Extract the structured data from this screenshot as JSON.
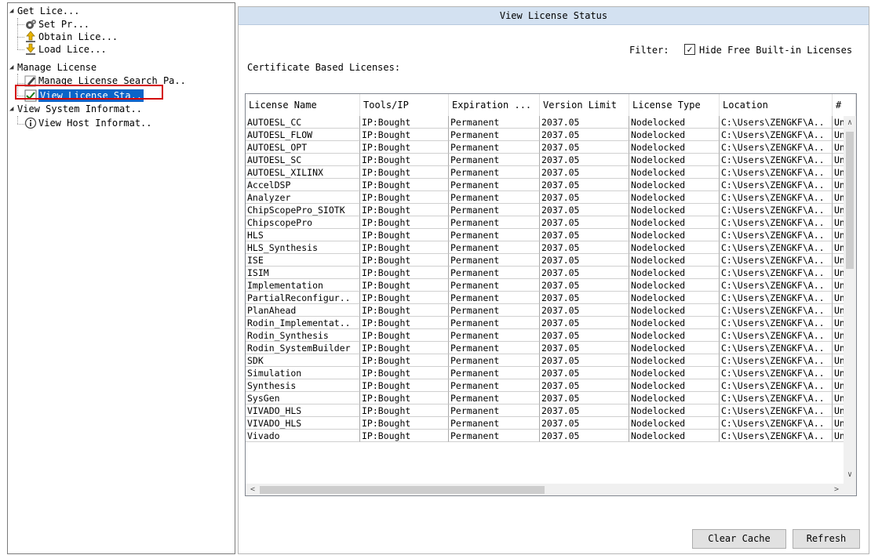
{
  "tree": {
    "items": [
      {
        "label": "Get Lice...",
        "icon": "triangle-expanded",
        "level": 0
      },
      {
        "label": "Set Pr...",
        "icon": "gear-icon",
        "level": 1
      },
      {
        "label": "Obtain Lice...",
        "icon": "arrow-up-icon",
        "level": 1
      },
      {
        "label": "Load Lice...",
        "icon": "arrow-down-icon",
        "level": 1
      },
      {
        "label": "Manage License",
        "icon": "triangle-expanded",
        "level": 0
      },
      {
        "label": "Manage License Search Pa..",
        "icon": "pencil-icon",
        "level": 1
      },
      {
        "label": "View License Sta..",
        "icon": "checkmark-icon",
        "level": 1,
        "selected": true
      },
      {
        "label": "View System Informat..",
        "icon": "triangle-expanded",
        "level": 0
      },
      {
        "label": "View Host Informat..",
        "icon": "info-icon",
        "level": 1
      }
    ]
  },
  "panel": {
    "title": "View License Status",
    "cert_label": "Certificate Based Licenses:",
    "filter_label": "Filter:",
    "filter_checkbox_checked": true,
    "filter_checkbox_label": "Hide Free Built-in Licenses"
  },
  "table": {
    "columns": [
      "License Name",
      "Tools/IP",
      "Expiration ...",
      "Version Limit",
      "License Type",
      "Location",
      "#"
    ],
    "rows": [
      [
        "AUTOESL_CC",
        "IP:Bought",
        "Permanent",
        "2037.05",
        "Nodelocked",
        "C:\\Users\\ZENGKF\\A..",
        "Un"
      ],
      [
        "AUTOESL_FLOW",
        "IP:Bought",
        "Permanent",
        "2037.05",
        "Nodelocked",
        "C:\\Users\\ZENGKF\\A..",
        "Un"
      ],
      [
        "AUTOESL_OPT",
        "IP:Bought",
        "Permanent",
        "2037.05",
        "Nodelocked",
        "C:\\Users\\ZENGKF\\A..",
        "Un"
      ],
      [
        "AUTOESL_SC",
        "IP:Bought",
        "Permanent",
        "2037.05",
        "Nodelocked",
        "C:\\Users\\ZENGKF\\A..",
        "Un"
      ],
      [
        "AUTOESL_XILINX",
        "IP:Bought",
        "Permanent",
        "2037.05",
        "Nodelocked",
        "C:\\Users\\ZENGKF\\A..",
        "Un"
      ],
      [
        "AccelDSP",
        "IP:Bought",
        "Permanent",
        "2037.05",
        "Nodelocked",
        "C:\\Users\\ZENGKF\\A..",
        "Un"
      ],
      [
        "Analyzer",
        "IP:Bought",
        "Permanent",
        "2037.05",
        "Nodelocked",
        "C:\\Users\\ZENGKF\\A..",
        "Un"
      ],
      [
        "ChipScopePro_SIOTK",
        "IP:Bought",
        "Permanent",
        "2037.05",
        "Nodelocked",
        "C:\\Users\\ZENGKF\\A..",
        "Un"
      ],
      [
        "ChipscopePro",
        "IP:Bought",
        "Permanent",
        "2037.05",
        "Nodelocked",
        "C:\\Users\\ZENGKF\\A..",
        "Un"
      ],
      [
        "HLS",
        "IP:Bought",
        "Permanent",
        "2037.05",
        "Nodelocked",
        "C:\\Users\\ZENGKF\\A..",
        "Un"
      ],
      [
        "HLS_Synthesis",
        "IP:Bought",
        "Permanent",
        "2037.05",
        "Nodelocked",
        "C:\\Users\\ZENGKF\\A..",
        "Un"
      ],
      [
        "ISE",
        "IP:Bought",
        "Permanent",
        "2037.05",
        "Nodelocked",
        "C:\\Users\\ZENGKF\\A..",
        "Un"
      ],
      [
        "ISIM",
        "IP:Bought",
        "Permanent",
        "2037.05",
        "Nodelocked",
        "C:\\Users\\ZENGKF\\A..",
        "Un"
      ],
      [
        "Implementation",
        "IP:Bought",
        "Permanent",
        "2037.05",
        "Nodelocked",
        "C:\\Users\\ZENGKF\\A..",
        "Un"
      ],
      [
        "PartialReconfigur..",
        "IP:Bought",
        "Permanent",
        "2037.05",
        "Nodelocked",
        "C:\\Users\\ZENGKF\\A..",
        "Un"
      ],
      [
        "PlanAhead",
        "IP:Bought",
        "Permanent",
        "2037.05",
        "Nodelocked",
        "C:\\Users\\ZENGKF\\A..",
        "Un"
      ],
      [
        "Rodin_Implementat..",
        "IP:Bought",
        "Permanent",
        "2037.05",
        "Nodelocked",
        "C:\\Users\\ZENGKF\\A..",
        "Un"
      ],
      [
        "Rodin_Synthesis",
        "IP:Bought",
        "Permanent",
        "2037.05",
        "Nodelocked",
        "C:\\Users\\ZENGKF\\A..",
        "Un"
      ],
      [
        "Rodin_SystemBuilder",
        "IP:Bought",
        "Permanent",
        "2037.05",
        "Nodelocked",
        "C:\\Users\\ZENGKF\\A..",
        "Un"
      ],
      [
        "SDK",
        "IP:Bought",
        "Permanent",
        "2037.05",
        "Nodelocked",
        "C:\\Users\\ZENGKF\\A..",
        "Un"
      ],
      [
        "Simulation",
        "IP:Bought",
        "Permanent",
        "2037.05",
        "Nodelocked",
        "C:\\Users\\ZENGKF\\A..",
        "Un"
      ],
      [
        "Synthesis",
        "IP:Bought",
        "Permanent",
        "2037.05",
        "Nodelocked",
        "C:\\Users\\ZENGKF\\A..",
        "Un"
      ],
      [
        "SysGen",
        "IP:Bought",
        "Permanent",
        "2037.05",
        "Nodelocked",
        "C:\\Users\\ZENGKF\\A..",
        "Un"
      ],
      [
        "VIVADO_HLS",
        "IP:Bought",
        "Permanent",
        "2037.05",
        "Nodelocked",
        "C:\\Users\\ZENGKF\\A..",
        "Un"
      ],
      [
        "VIVADO_HLS",
        "IP:Bought",
        "Permanent",
        "2037.05",
        "Nodelocked",
        "C:\\Users\\ZENGKF\\A..",
        "Un"
      ],
      [
        "Vivado",
        "IP:Bought",
        "Permanent",
        "2037.05",
        "Nodelocked",
        "C:\\Users\\ZENGKF\\A..",
        "Un"
      ]
    ]
  },
  "buttons": {
    "clear_cache": "Clear Cache",
    "refresh": "Refresh"
  },
  "colors": {
    "title_bar": "#d3e1f1",
    "selection": "#0a64c8",
    "selection_outline": "#d40000"
  }
}
